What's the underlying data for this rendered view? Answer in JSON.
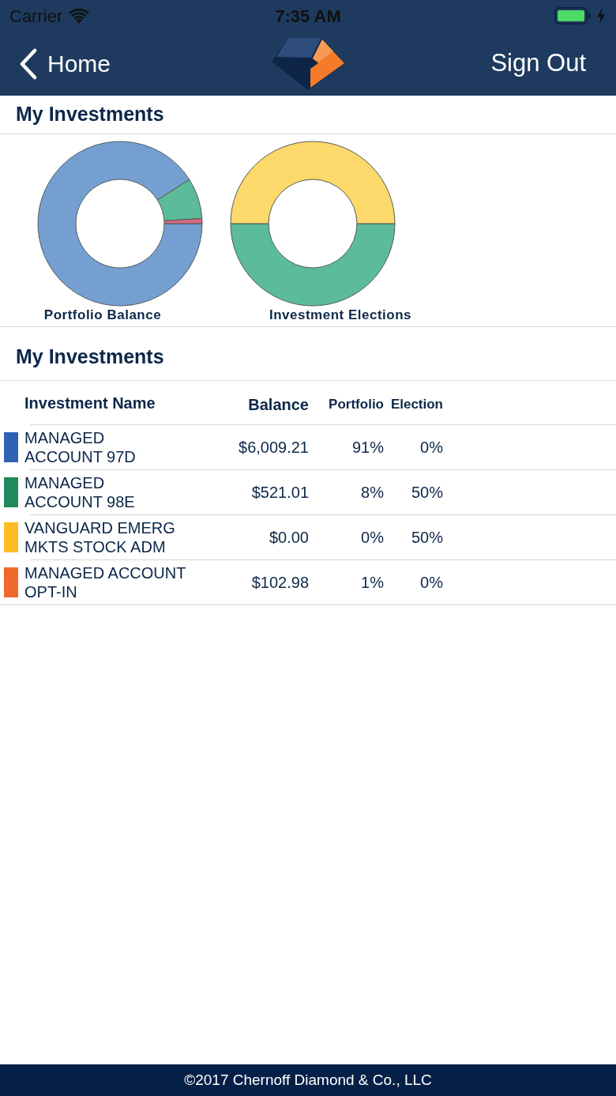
{
  "status_bar": {
    "carrier": "Carrier",
    "time": "7:35 AM"
  },
  "nav_bar": {
    "back": "Home",
    "action": "Sign Out"
  },
  "charts_section": {
    "title": "My Investments",
    "charts": [
      {
        "chart_data": {
          "type": "donut",
          "title": "Portfolio Balance",
          "values": [
            91,
            8,
            0,
            1
          ]
        }
      },
      {
        "chart_data": {
          "type": "donut",
          "title": "Investment Elections",
          "values": [
            0,
            50,
            50,
            0
          ]
        }
      }
    ]
  },
  "table_section": {
    "title": "My Investments",
    "columns": [
      "Investment Name",
      "Balance",
      "Portfolio",
      "Election"
    ],
    "rows": [
      {
        "name": "MANAGED\nACCOUNT 97D",
        "color": "#2f62b3",
        "balance": "$6,009.21",
        "portfolio": "91%",
        "election": "0%"
      },
      {
        "name": "MANAGED\nACCOUNT 98E",
        "color": "#1f8a5c",
        "balance": "$521.01",
        "portfolio": "8%",
        "election": "50%"
      },
      {
        "name": "VANGUARD EMERG\nMKTS STOCK ADM",
        "color": "#fbbd22",
        "balance": "$0.00",
        "portfolio": "0%",
        "election": "50%"
      },
      {
        "name": "MANAGED ACCOUNT\nOPT-IN",
        "color": "#ef6a2a",
        "balance": "$102.98",
        "portfolio": "1%",
        "election": "0%"
      }
    ]
  },
  "footer": {
    "text": "©2017 Chernoff Diamond & Co., LLC"
  }
}
